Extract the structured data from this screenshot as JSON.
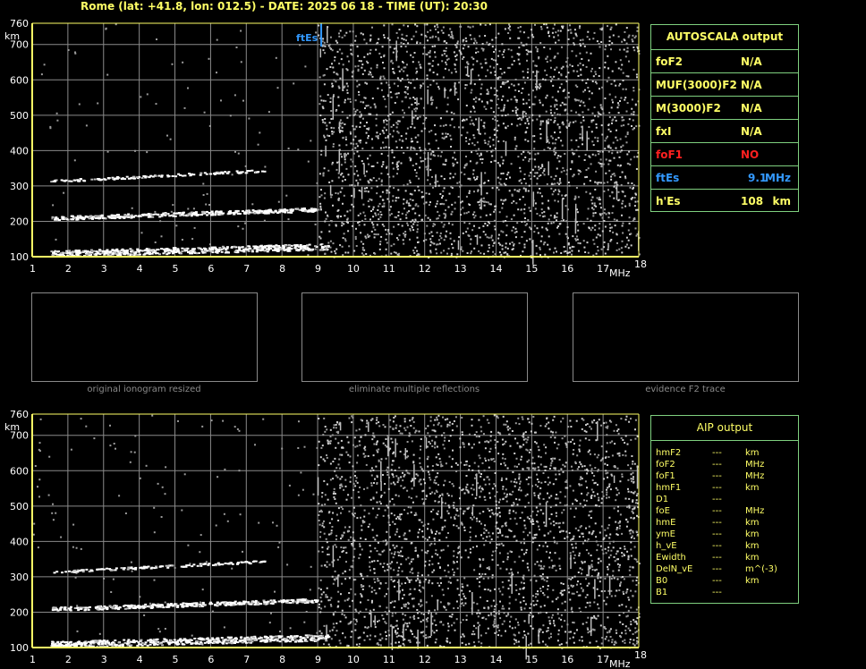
{
  "header": {
    "title": "Rome (lat: +41.8, lon: 012.5) - DATE: 2025 06 18 - TIME (UT): 20:30"
  },
  "colors": {
    "axis": "#ffff66",
    "grid": "#8a8a8a",
    "panel_border": "#7fd07f",
    "text_yellow": "#ffff66",
    "text_red": "#ff2020",
    "text_blue": "#3399ff",
    "trace": "#ffffff",
    "noise": "#cfcfcf"
  },
  "autoscala": {
    "title": "AUTOSCALA output",
    "rows": [
      {
        "label": "foF2",
        "value": "N/A",
        "unit": "",
        "color": "#ffff66"
      },
      {
        "label": "MUF(3000)F2",
        "value": "N/A",
        "unit": "",
        "color": "#ffff66"
      },
      {
        "label": "M(3000)F2",
        "value": "N/A",
        "unit": "",
        "color": "#ffff66"
      },
      {
        "label": "fxI",
        "value": "N/A",
        "unit": "",
        "color": "#ffff66"
      },
      {
        "label": "foF1",
        "value": "NO",
        "unit": "",
        "color": "#ff2020"
      },
      {
        "label": "ftEs",
        "value": "9.1",
        "unit": "MHz",
        "color": "#3399ff"
      },
      {
        "label": "h'Es",
        "value": "108",
        "unit": "km",
        "color": "#ffff66"
      }
    ]
  },
  "aip": {
    "title": "AIP output",
    "rows": [
      {
        "param": "hmF2",
        "value": "---",
        "unit": "km"
      },
      {
        "param": "foF2",
        "value": "---",
        "unit": "MHz"
      },
      {
        "param": "foF1",
        "value": "---",
        "unit": "MHz"
      },
      {
        "param": "hmF1",
        "value": "---",
        "unit": "km"
      },
      {
        "param": "D1",
        "value": "---",
        "unit": ""
      },
      {
        "param": "foE",
        "value": "---",
        "unit": "MHz"
      },
      {
        "param": "hmE",
        "value": "---",
        "unit": "km"
      },
      {
        "param": "ymE",
        "value": "---",
        "unit": "km"
      },
      {
        "param": "h_vE",
        "value": "---",
        "unit": "km"
      },
      {
        "param": "Ewidth",
        "value": "---",
        "unit": "km"
      },
      {
        "param": "DelN_vE",
        "value": "---",
        "unit": "m^(-3)"
      },
      {
        "param": "B0",
        "value": "---",
        "unit": "km"
      },
      {
        "param": "B1",
        "value": "---",
        "unit": ""
      }
    ]
  },
  "thumbnails": [
    {
      "caption": "original ionogram resized",
      "variant": "original"
    },
    {
      "caption": "eliminate multiple reflections",
      "variant": "original"
    },
    {
      "caption": "evidence F2 trace",
      "variant": "f2"
    }
  ],
  "chart_data": [
    {
      "type": "scatter",
      "name": "ionogram-top",
      "xunit": "MHz",
      "yunit": "km",
      "xlim": [
        1,
        18
      ],
      "ylim": [
        100,
        760
      ],
      "xticks": [
        1,
        2,
        3,
        4,
        5,
        6,
        7,
        8,
        9,
        10,
        11,
        12,
        13,
        14,
        15,
        16,
        17,
        18
      ],
      "yticks": [
        100,
        200,
        300,
        400,
        500,
        600,
        700,
        760
      ],
      "grid": true,
      "marker": {
        "label": "ftEs",
        "x": 9.1
      },
      "traces": [
        {
          "name": "Es",
          "x_range": [
            1.5,
            9.3
          ],
          "h_start": 110,
          "h_end": 130
        },
        {
          "name": "2Es",
          "x_range": [
            1.5,
            9.0
          ],
          "h_start": 210,
          "h_end": 235
        },
        {
          "name": "3Es",
          "x_range": [
            1.5,
            7.5
          ],
          "h_start": 315,
          "h_end": 345
        }
      ]
    },
    {
      "type": "scatter",
      "name": "ionogram-bottom",
      "xunit": "MHz",
      "yunit": "km",
      "xlim": [
        1,
        18
      ],
      "ylim": [
        100,
        760
      ],
      "xticks": [
        1,
        2,
        3,
        4,
        5,
        6,
        7,
        8,
        9,
        10,
        11,
        12,
        13,
        14,
        15,
        16,
        17,
        18
      ],
      "yticks": [
        100,
        200,
        300,
        400,
        500,
        600,
        700,
        760
      ],
      "grid": true,
      "traces": [
        {
          "name": "Es",
          "x_range": [
            1.5,
            9.3
          ],
          "h_start": 110,
          "h_end": 130
        },
        {
          "name": "2Es",
          "x_range": [
            1.5,
            9.0
          ],
          "h_start": 210,
          "h_end": 235
        },
        {
          "name": "3Es",
          "x_range": [
            1.5,
            7.5
          ],
          "h_start": 315,
          "h_end": 345
        }
      ]
    }
  ]
}
